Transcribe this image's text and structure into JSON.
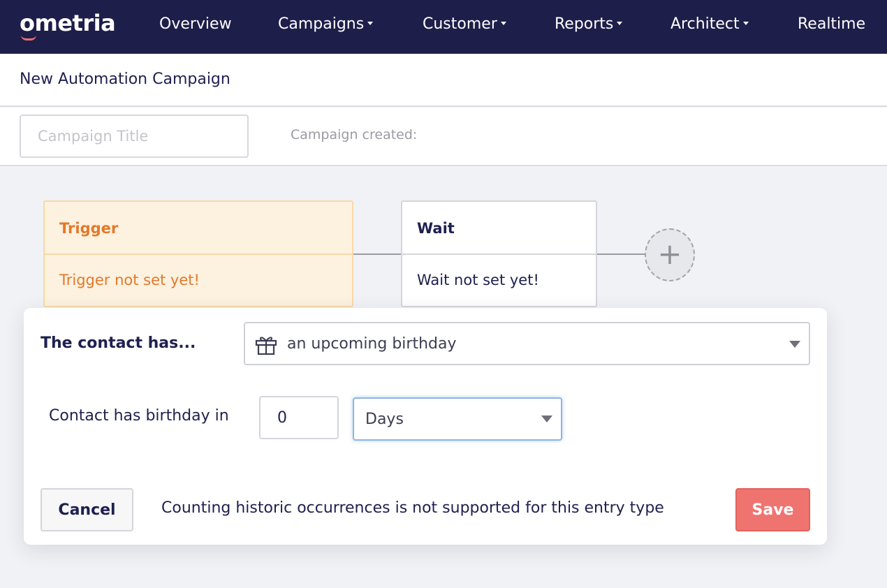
{
  "brand": {
    "logo": "ometria",
    "accent": "#ef6f6c",
    "nav_bg": "#1e1e4a"
  },
  "nav": {
    "items": [
      {
        "label": "Overview",
        "has_dropdown": false
      },
      {
        "label": "Campaigns",
        "has_dropdown": true
      },
      {
        "label": "Customer",
        "has_dropdown": true
      },
      {
        "label": "Reports",
        "has_dropdown": true
      },
      {
        "label": "Architect",
        "has_dropdown": true
      },
      {
        "label": "Realtime",
        "has_dropdown": false
      }
    ]
  },
  "page": {
    "title": "New Automation Campaign"
  },
  "campaign": {
    "title_placeholder": "Campaign Title",
    "title_value": "",
    "created_label": "Campaign created:"
  },
  "flow": {
    "trigger": {
      "header": "Trigger",
      "body": "Trigger not set yet!"
    },
    "wait": {
      "header": "Wait",
      "body": "Wait not set yet!"
    },
    "add_icon": "plus-icon"
  },
  "panel": {
    "contact_has_label": "The contact has...",
    "event": {
      "icon": "gift-icon",
      "value": "an upcoming birthday"
    },
    "birthday_label": "Contact has birthday in",
    "birthday_value": "0",
    "unit": "Days",
    "cancel_label": "Cancel",
    "note": "Counting historic occurrences is not supported for this entry type",
    "save_label": "Save"
  }
}
